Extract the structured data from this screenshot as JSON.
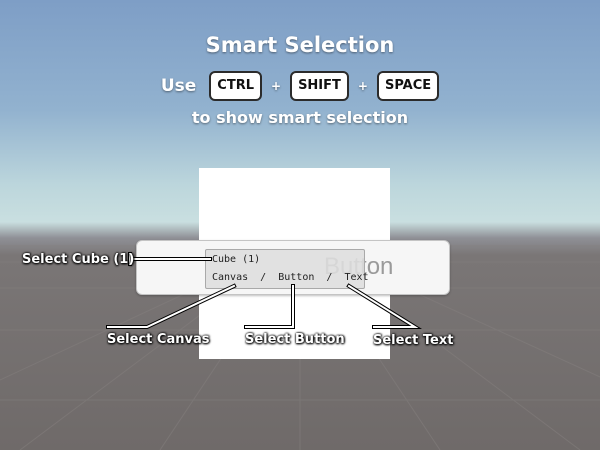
{
  "header": {
    "title": "Smart Selection",
    "use_word": "Use",
    "keys": [
      "CTRL",
      "SHIFT",
      "SPACE"
    ],
    "plus": "+",
    "subtitle": "to show smart selection"
  },
  "scene": {
    "button_text": "Button"
  },
  "popup": {
    "item_cube": "Cube (1)",
    "path_canvas": "Canvas",
    "path_button": "Button",
    "path_text": "Text",
    "separator": "/"
  },
  "callouts": {
    "select_cube": "Select Cube (1)",
    "select_canvas": "Select Canvas",
    "select_button": "Select Button",
    "select_text": "Select Text"
  },
  "colors": {
    "sky_top": "#7e9ec6",
    "horizon": "#c9dfe0",
    "ground": "#6f6a69",
    "key_bg": "#ffffff",
    "key_border": "#2b2b2b"
  }
}
